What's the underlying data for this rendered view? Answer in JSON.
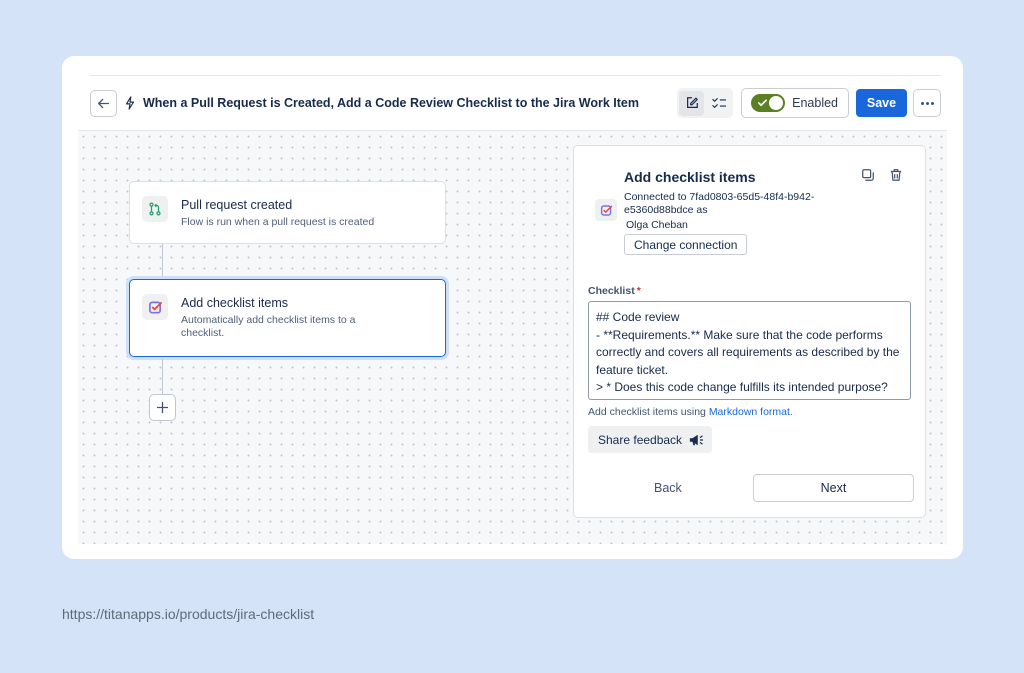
{
  "header": {
    "title": "When a Pull Request is Created, Add a Code Review Checklist to the Jira Work Item",
    "enabled_label": "Enabled",
    "save_label": "Save"
  },
  "flow": {
    "trigger": {
      "title": "Pull request created",
      "subtitle": "Flow is run when a pull request is created"
    },
    "action": {
      "title": "Add checklist items",
      "subtitle": "Automatically add checklist items to a checklist."
    }
  },
  "panel": {
    "title": "Add checklist items",
    "connection_text": "Connected to 7fad0803-65d5-48f4-b942-e5360d88bdce as",
    "user": "Olga Cheban",
    "change_connection_label": "Change connection",
    "checklist_label": "Checklist",
    "required_mark": "*",
    "checklist_value": "## Code review\n- **Requirements.** Make sure that the code performs correctly and covers all requirements as described by the feature ticket.\n> * Does this code change fulfills its intended purpose?",
    "hint_prefix": "Add checklist items using ",
    "hint_link": "Markdown format.",
    "feedback_label": "Share feedback",
    "back_label": "Back",
    "next_label": "Next"
  },
  "footer": {
    "url": "https://titanapps.io/products/jira-checklist"
  },
  "colors": {
    "background": "#d4e3f8",
    "primary": "#1868db",
    "toggle_on": "#5b7f24"
  }
}
